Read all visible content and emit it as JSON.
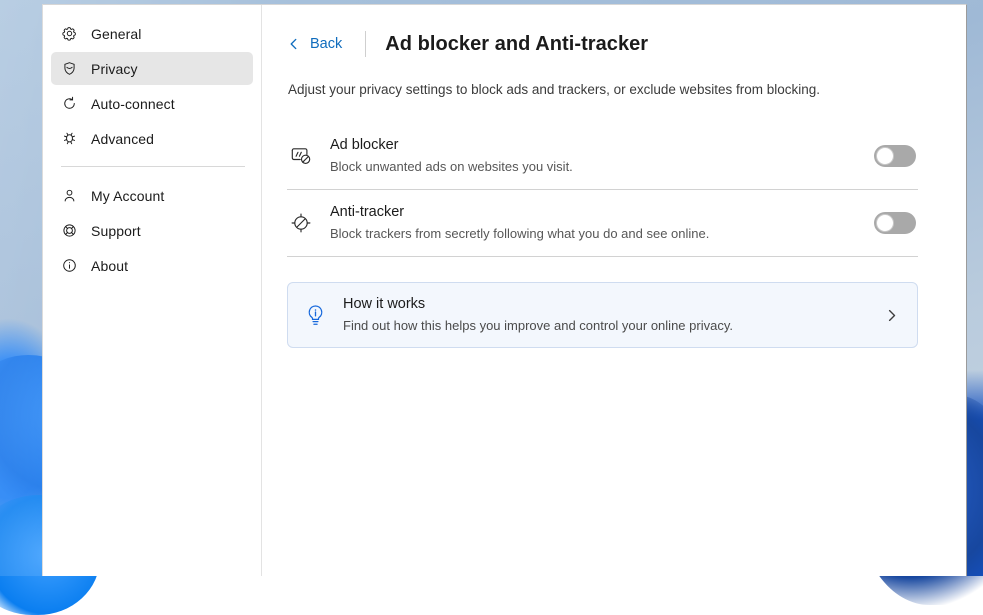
{
  "sidebar": {
    "items": [
      {
        "label": "General",
        "icon": "gear-icon",
        "selected": false
      },
      {
        "label": "Privacy",
        "icon": "shield-icon",
        "selected": true
      },
      {
        "label": "Auto-connect",
        "icon": "refresh-icon",
        "selected": false
      },
      {
        "label": "Advanced",
        "icon": "bug-gear-icon",
        "selected": false
      }
    ],
    "items_secondary": [
      {
        "label": "My Account",
        "icon": "person-icon",
        "selected": false
      },
      {
        "label": "Support",
        "icon": "support-icon",
        "selected": false
      },
      {
        "label": "About",
        "icon": "info-icon",
        "selected": false
      }
    ]
  },
  "header": {
    "back_label": "Back",
    "back_icon": "chevron-left-icon",
    "title": "Ad blocker and Anti-tracker",
    "subtitle": "Adjust your privacy settings to block ads and trackers, or exclude websites from blocking."
  },
  "settings": [
    {
      "title": "Ad blocker",
      "description": "Block unwanted ads on websites you visit.",
      "icon": "ad-blocked-icon",
      "toggle_state": "off"
    },
    {
      "title": "Anti-tracker",
      "description": "Block trackers from secretly following what you do and see online.",
      "icon": "tracker-blocked-icon",
      "toggle_state": "off"
    }
  ],
  "info_card": {
    "title": "How it works",
    "description": "Find out how this helps you improve and control your online privacy.",
    "icon": "lightbulb-info-icon",
    "chevron_icon": "chevron-right-icon"
  },
  "colors": {
    "accent_link": "#0f6cbd",
    "card_background": "#f3f7fd",
    "card_border": "#cfdcf0",
    "selected_nav": "#e6e6e6",
    "toggle_off_track": "#a9a9a9",
    "info_icon": "#1668dc"
  }
}
